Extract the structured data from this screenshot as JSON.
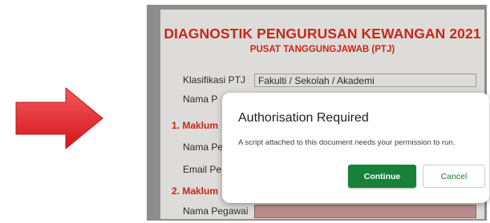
{
  "colors": {
    "arrow": "#e8242a",
    "heading_red": "#c8261d",
    "continue_green": "#188038"
  },
  "decor": {
    "arrow_icon": "right-arrow-icon"
  },
  "sheet": {
    "title": "DIAGNOSTIK PENGURUSAN KEWANGAN 2021",
    "subtitle": "PUSAT TANGGUNGJAWAB (PTJ)",
    "labels": {
      "klasifikasi": "Klasifikasi PTJ",
      "nama_ptj": "Nama P",
      "maklumat_1": "1. Maklum",
      "nama_pegawai_1": "Nama Pe",
      "email_pegawai": "Email Pe",
      "maklumat_2": "2. Maklum",
      "nama_pegawai_2": "Nama Pegawai"
    },
    "klasifikasi_value": "Fakulti / Sekolah / Akademi"
  },
  "dialog": {
    "title": "Authorisation Required",
    "message": "A script attached to this document needs your permission to run.",
    "continue_label": "Continue",
    "cancel_label": "Cancel"
  }
}
